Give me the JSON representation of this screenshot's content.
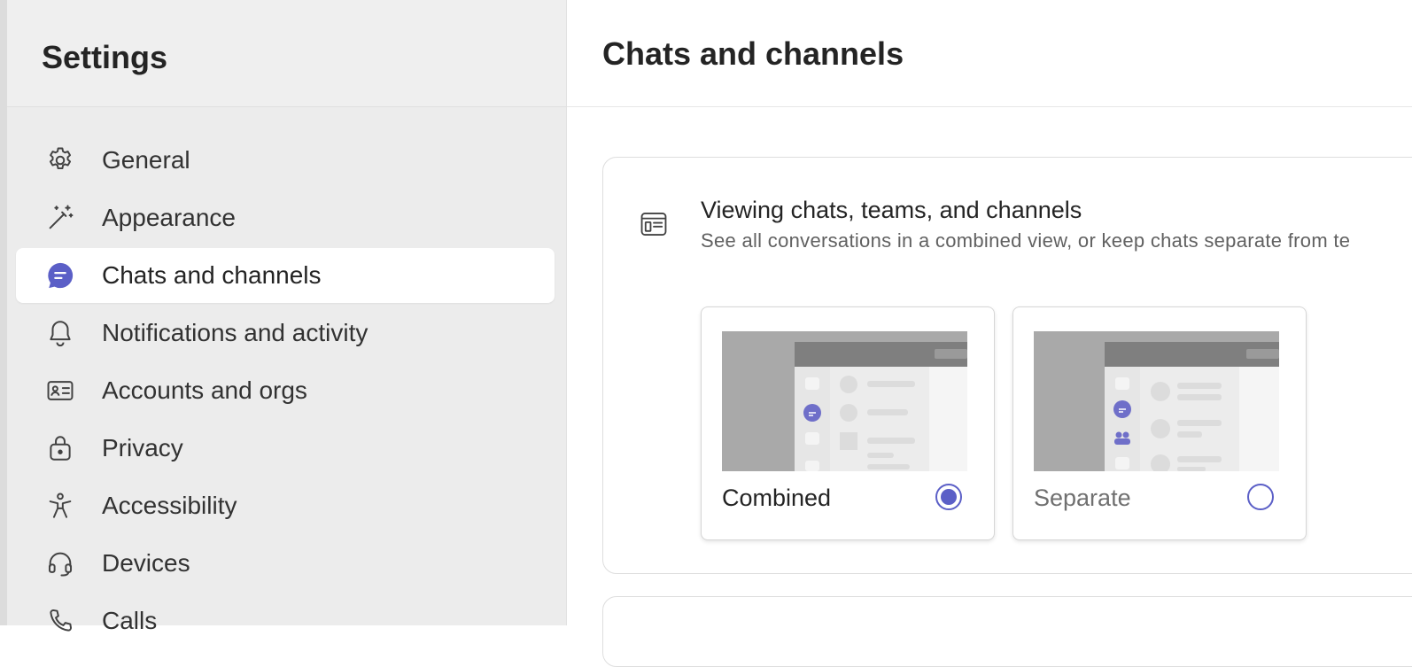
{
  "sidebar": {
    "title": "Settings",
    "items": [
      {
        "label": "General",
        "icon": "gear-icon"
      },
      {
        "label": "Appearance",
        "icon": "magic-wand-icon"
      },
      {
        "label": "Chats and channels",
        "icon": "chat-bubble-icon",
        "active": true
      },
      {
        "label": "Notifications and activity",
        "icon": "bell-icon"
      },
      {
        "label": "Accounts and orgs",
        "icon": "id-card-icon"
      },
      {
        "label": "Privacy",
        "icon": "lock-icon"
      },
      {
        "label": "Accessibility",
        "icon": "accessibility-icon"
      },
      {
        "label": "Devices",
        "icon": "headset-icon"
      },
      {
        "label": "Calls",
        "icon": "phone-icon"
      }
    ]
  },
  "main": {
    "title": "Chats and channels",
    "section": {
      "icon": "layout-icon",
      "title": "Viewing chats, teams, and channels",
      "description": "See all conversations in a combined view, or keep chats separate from te",
      "options": [
        {
          "label": "Combined",
          "selected": true
        },
        {
          "label": "Separate",
          "selected": false
        }
      ]
    }
  },
  "colors": {
    "accent": "#5b5fc7",
    "sidebar_bg": "#ececec"
  }
}
